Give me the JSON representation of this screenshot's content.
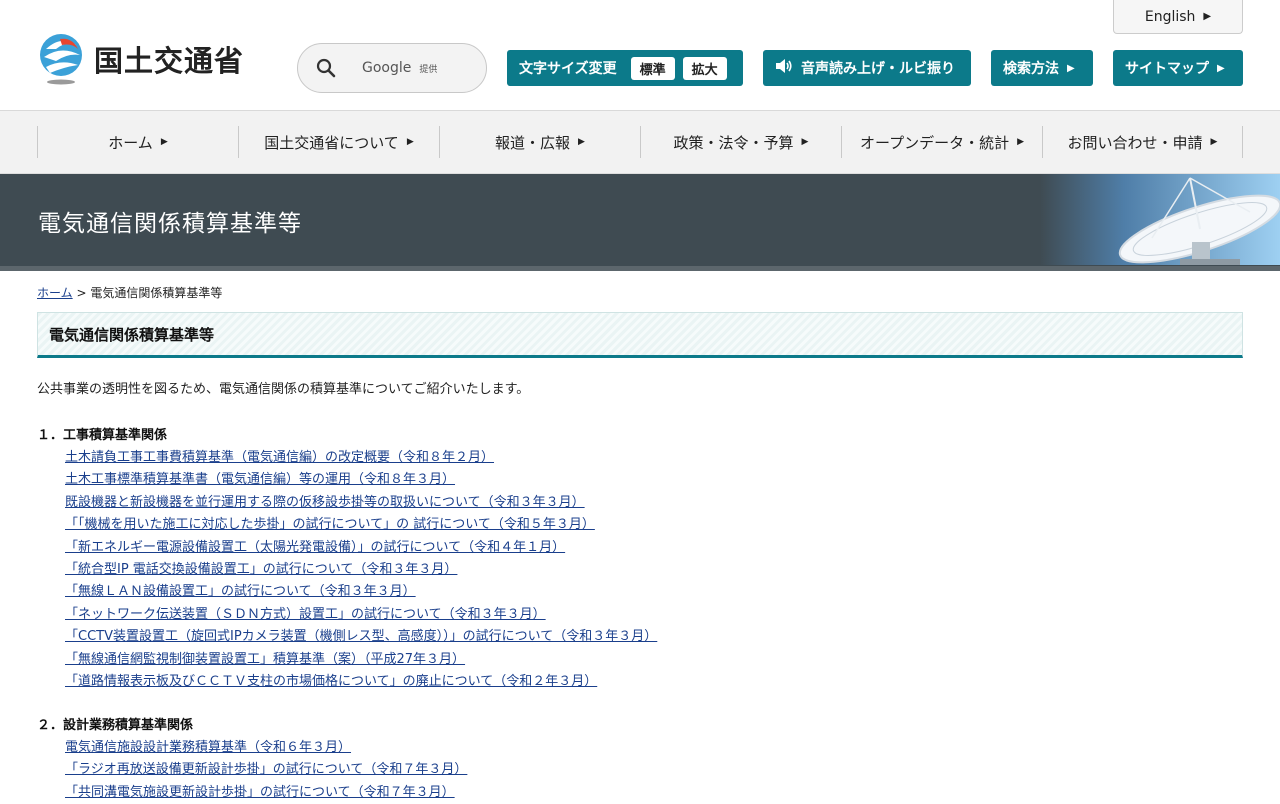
{
  "header": {
    "logo_text": "国土交通省",
    "search_label": "Google",
    "search_sub": "提供",
    "english": "English",
    "font_size_label": "文字サイズ変更",
    "font_standard": "標準",
    "font_large": "拡大",
    "voice": "音声読み上げ・ルビ振り",
    "search_method": "検索方法",
    "sitemap": "サイトマップ"
  },
  "nav": [
    {
      "label": "ホーム"
    },
    {
      "label": "国土交通省について"
    },
    {
      "label": "報道・広報"
    },
    {
      "label": "政策・法令・予算"
    },
    {
      "label": "オープンデータ・統計"
    },
    {
      "label": "お問い合わせ・申請"
    }
  ],
  "banner": {
    "title": "電気通信関係積算基準等"
  },
  "breadcrumb": {
    "home": "ホーム",
    "sep": ">",
    "current": "電気通信関係積算基準等"
  },
  "section_title": "電気通信関係積算基準等",
  "intro": "公共事業の透明性を図るため、電気通信関係の積算基準についてご紹介いたします。",
  "groups": [
    {
      "heading": "１．工事積算基準関係",
      "links": [
        "土木請負工事工事費積算基準（電気通信編）の改定概要（令和８年２月）",
        "土木工事標準積算基準書（電気通信編）等の運用（令和８年３月）",
        "既設機器と新設機器を並行運用する際の仮移設歩掛等の取扱いについて（令和３年３月）",
        "「「機械を用いた施工に対応した歩掛」の試行について」の 試行について（令和５年３月）",
        "「新エネルギー電源設備設置工（太陽光発電設備）」の試行について（令和４年１月）",
        "「統合型IP 電話交換設備設置工」の試行について（令和３年３月）",
        "「無線ＬＡＮ設備設置工」の試行について（令和３年３月）",
        "「ネットワーク伝送装置（ＳＤＮ方式）設置工」の試行について（令和３年３月）",
        "「CCTV装置設置工（旋回式IPカメラ装置（機側レス型、高感度））」の試行について（令和３年３月）",
        "「無線通信網監視制御装置設置工」積算基準（案）（平成27年３月）",
        "「道路情報表示板及びＣＣＴＶ支柱の市場価格について」の廃止について（令和２年３月）"
      ]
    },
    {
      "heading": "２．設計業務積算基準関係",
      "links": [
        "電気通信施設設計業務積算基準（令和６年３月）",
        "「ラジオ再放送設備更新設計歩掛」の試行について（令和７年３月）",
        "「共同溝電気施設更新設計歩掛」の試行について（令和７年３月）"
      ]
    }
  ],
  "colors": {
    "accent": "#0c7a8a",
    "banner": "#3f4b52",
    "link": "#1a3f8c"
  },
  "icons": [
    "mlit-logo-icon",
    "search-icon",
    "speaker-icon",
    "arrow-right-icon",
    "satellite-dish-icon"
  ]
}
